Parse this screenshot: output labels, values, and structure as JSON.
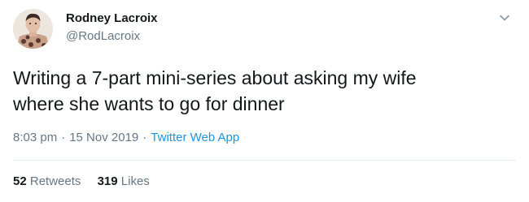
{
  "user": {
    "name": "Rodney Lacroix",
    "handle": "@RodLacroix",
    "avatar_icon": "user-avatar"
  },
  "menu": {
    "icon": "chevron-down-icon"
  },
  "tweet": {
    "text_line1": "Writing a 7-part mini-series about asking my wife",
    "text_line2": "where she wants to go for dinner"
  },
  "meta": {
    "time": "8:03 pm",
    "separator": "·",
    "date": "15 Nov 2019",
    "source": "Twitter Web App"
  },
  "stats": {
    "retweets_count": "52",
    "retweets_label": "Retweets",
    "likes_count": "319",
    "likes_label": "Likes"
  },
  "colors": {
    "link": "#1b95e0",
    "secondary_text": "#657786",
    "primary_text": "#14171a",
    "divider": "#e6ecf0"
  }
}
